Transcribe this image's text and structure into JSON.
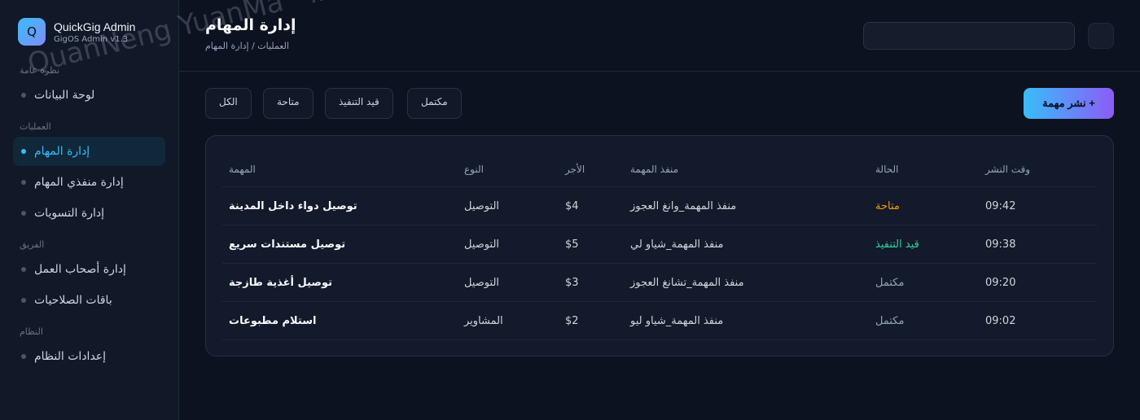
{
  "brand": {
    "logo_letter": "Q",
    "name": "QuickGig Admin",
    "version": "GigOS Admin v1.3"
  },
  "sidebar": {
    "sections": [
      {
        "label": "نظرة عامة",
        "items": [
          {
            "label": "لوحة البيانات",
            "active": false
          }
        ]
      },
      {
        "label": "العمليات",
        "items": [
          {
            "label": "إدارة المهام",
            "active": true
          },
          {
            "label": "إدارة منفذي المهام",
            "active": false
          },
          {
            "label": "إدارة التسويات",
            "active": false
          }
        ]
      },
      {
        "label": "الفريق",
        "items": [
          {
            "label": "إدارة أصحاب العمل",
            "active": false
          },
          {
            "label": "باقات الصلاحيات",
            "active": false
          }
        ]
      },
      {
        "label": "النظام",
        "items": [
          {
            "label": "إعدادات النظام",
            "active": false
          }
        ]
      }
    ]
  },
  "header": {
    "title": "إدارة المهام",
    "breadcrumb": "العمليات / إدارة المهام",
    "search_placeholder": ""
  },
  "toolbar": {
    "filters": [
      "الكل",
      "متاحة",
      "قيد التنفيذ",
      "مكتمل"
    ],
    "publish_label": "نشر مهمة +"
  },
  "table": {
    "columns": {
      "task": "المهمة",
      "type": "النوع",
      "pay": "الأجر",
      "executor": "منفذ المهمة",
      "status": "الحالة",
      "time": "وقت النشر"
    },
    "rows": [
      {
        "task": "توصيل دواء داخل المدينة",
        "type": "التوصيل",
        "pay": "$4",
        "executor": "منفذ المهمة_وانغ العجوز",
        "status": "متاحة",
        "status_kind": "available",
        "time": "09:42"
      },
      {
        "task": "توصيل مستندات سريع",
        "type": "التوصيل",
        "pay": "$5",
        "executor": "منفذ المهمة_شياو لي",
        "status": "قيد التنفيذ",
        "status_kind": "progress",
        "time": "09:38"
      },
      {
        "task": "توصيل أغذية طازجة",
        "type": "التوصيل",
        "pay": "$3",
        "executor": "منفذ المهمة_تشانغ العجوز",
        "status": "مكتمل",
        "status_kind": "done",
        "time": "09:20"
      },
      {
        "task": "استلام مطبوعات",
        "type": "المشاوير",
        "pay": "$2",
        "executor": "منفذ المهمة_شياو ليو",
        "status": "مكتمل",
        "status_kind": "done",
        "time": "09:02"
      }
    ]
  },
  "watermark": "QuanNeng YuanMa · inzyxuashop.com",
  "colors": {
    "accent": "#38bdf8",
    "status_available": "#f59e0b",
    "status_progress": "#34d399",
    "status_done": "#94a3b8"
  }
}
